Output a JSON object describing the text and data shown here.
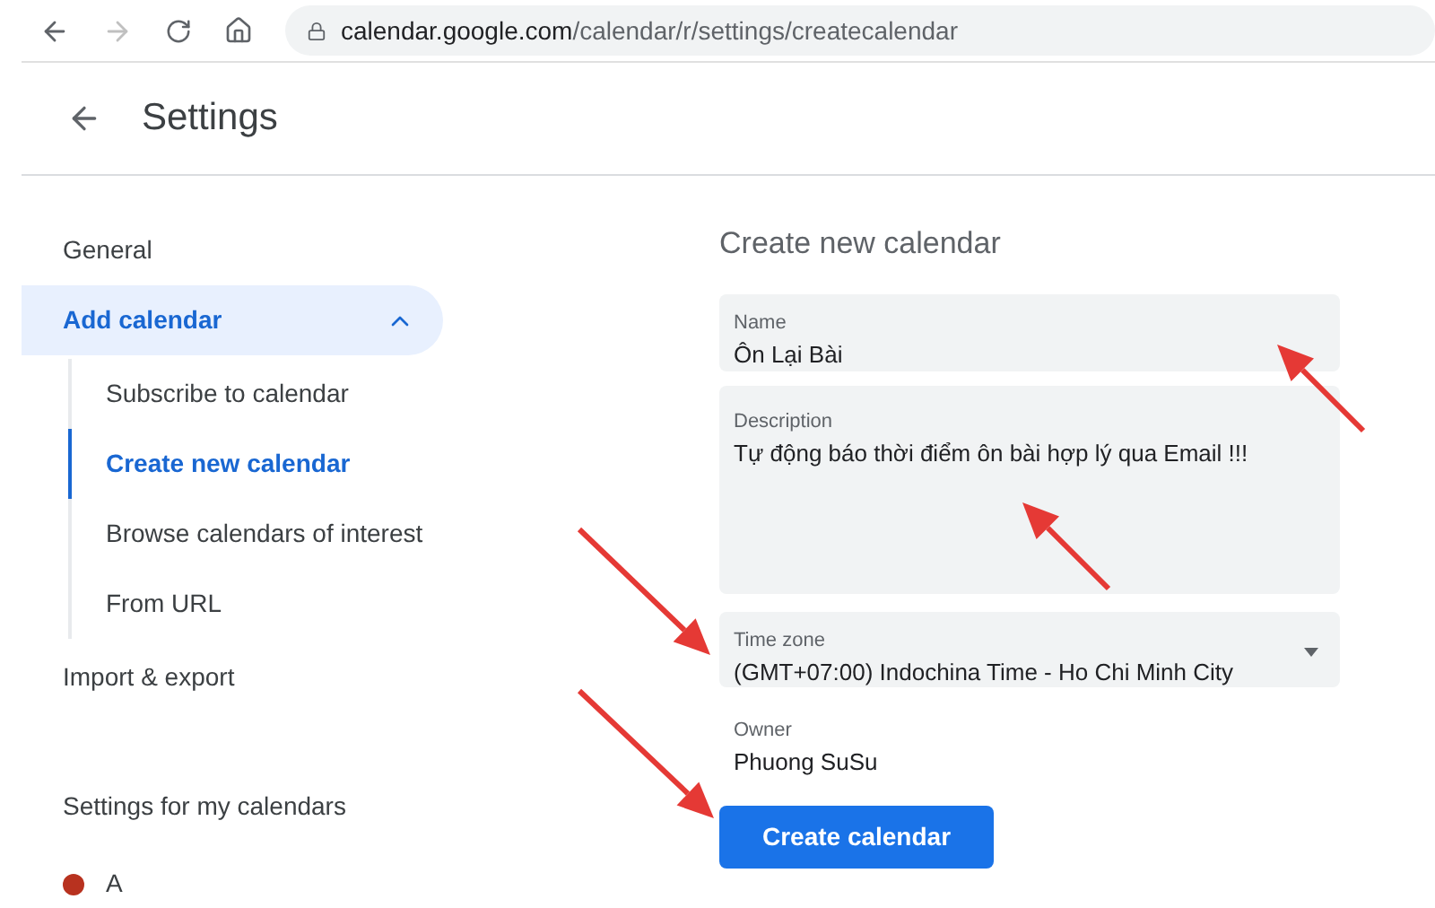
{
  "browser": {
    "url_host": "calendar.google.com",
    "url_path": "/calendar/r/settings/createcalendar"
  },
  "header": {
    "title": "Settings"
  },
  "sidebar": {
    "items": [
      {
        "label": "General",
        "selected": false
      },
      {
        "label": "Add calendar",
        "selected": true,
        "expanded": true,
        "children": [
          {
            "label": "Subscribe to calendar",
            "selected": false
          },
          {
            "label": "Create new calendar",
            "selected": true
          },
          {
            "label": "Browse calendars of interest",
            "selected": false
          },
          {
            "label": "From URL",
            "selected": false
          }
        ]
      },
      {
        "label": "Import & export",
        "selected": false
      }
    ],
    "section_title": "Settings for my calendars",
    "calendars": [
      {
        "label": "A",
        "color": "#b8321f"
      }
    ]
  },
  "form": {
    "title": "Create new calendar",
    "fields": [
      {
        "kind": "text",
        "label": "Name",
        "value": "Ôn Lại Bài"
      },
      {
        "kind": "textarea",
        "label": "Description",
        "value": "Tự động báo thời điểm ôn bài hợp lý qua Email !!!"
      },
      {
        "kind": "select",
        "label": "Time zone",
        "value": "(GMT+07:00) Indochina Time - Ho Chi Minh City"
      },
      {
        "kind": "static",
        "label": "Owner",
        "value": "Phuong SuSu"
      }
    ],
    "submit": "Create calendar"
  }
}
